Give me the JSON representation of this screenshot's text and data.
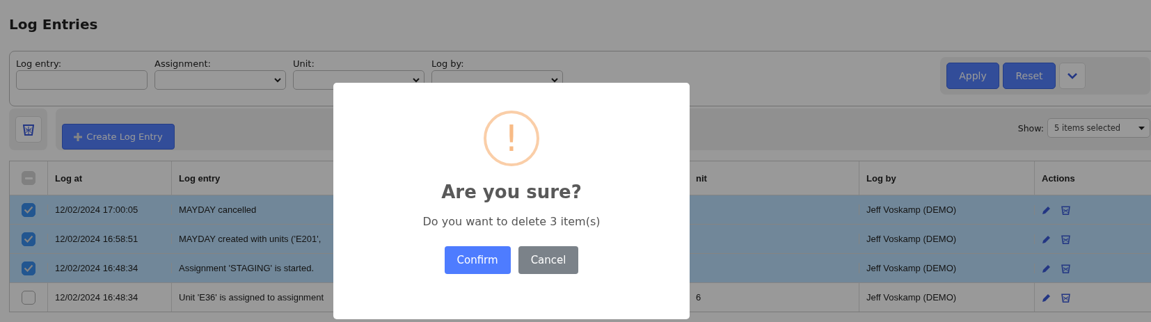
{
  "page": {
    "title": "Log Entries"
  },
  "filters": [
    {
      "label": "Log entry:",
      "kind": "text"
    },
    {
      "label": "Assignment:",
      "kind": "select"
    },
    {
      "label": "Unit:",
      "kind": "select"
    },
    {
      "label": "Log by:",
      "kind": "select"
    }
  ],
  "filter_buttons": {
    "apply": "Apply",
    "reset": "Reset"
  },
  "toolbar": {
    "create_button": "Create Log Entry",
    "show_label": "Show:",
    "show_value": "5 items selected"
  },
  "table": {
    "select_all": {
      "partial": true
    },
    "columns": [
      "Log at",
      "Log entry",
      "nit",
      "Log by",
      "Actions"
    ],
    "rows": [
      {
        "selected": true,
        "log_at": "12/02/2024 17:00:05",
        "log_entry": "MAYDAY cancelled",
        "log_by": "Jeff Voskamp (DEMO)"
      },
      {
        "selected": true,
        "log_at": "12/02/2024 16:58:51",
        "log_entry": "MAYDAY created with units ('E201',",
        "log_by": "Jeff Voskamp (DEMO)"
      },
      {
        "selected": true,
        "log_at": "12/02/2024 16:48:34",
        "log_entry": "Assignment 'STAGING' is started.",
        "log_by": "Jeff Voskamp (DEMO)"
      },
      {
        "selected": false,
        "log_at": "12/02/2024 16:48:34",
        "log_entry": "Unit 'E36' is assigned to assignment",
        "unit": "6",
        "log_by": "Jeff Voskamp (DEMO)"
      }
    ]
  },
  "dialog": {
    "icon": "!",
    "title": "Are you sure?",
    "message": "Do you want to delete 3 item(s)",
    "confirm": "Confirm",
    "cancel": "Cancel"
  }
}
